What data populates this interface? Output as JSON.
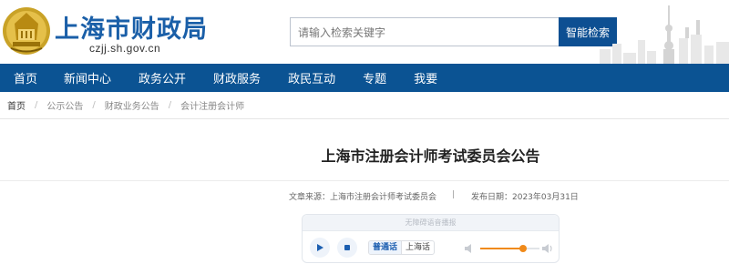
{
  "header": {
    "title": "上海市财政局",
    "domain": "czjj.sh.gov.cn",
    "search_placeholder": "请输入检索关键字",
    "search_button": "智能检索"
  },
  "nav": {
    "items": [
      "首页",
      "新闻中心",
      "政务公开",
      "财政服务",
      "政民互动",
      "专题",
      "我要"
    ]
  },
  "breadcrumb": {
    "items": [
      "首页",
      "公示公告",
      "财政业务公告",
      "会计注册会计师"
    ]
  },
  "article": {
    "title": "上海市注册会计师考试委员会公告",
    "source": "文章来源：上海市注册会计师考试委员会",
    "separator": "|",
    "date": "发布日期：2023年03月31日"
  },
  "player": {
    "header": "无障碍语音播报",
    "lang_active": "普通话",
    "lang_inactive": "上海话",
    "volume_level": 0.72
  },
  "colors": {
    "brand_blue": "#1a5fa8",
    "nav_blue": "#0b5393",
    "accent_orange": "#f08a1a"
  }
}
